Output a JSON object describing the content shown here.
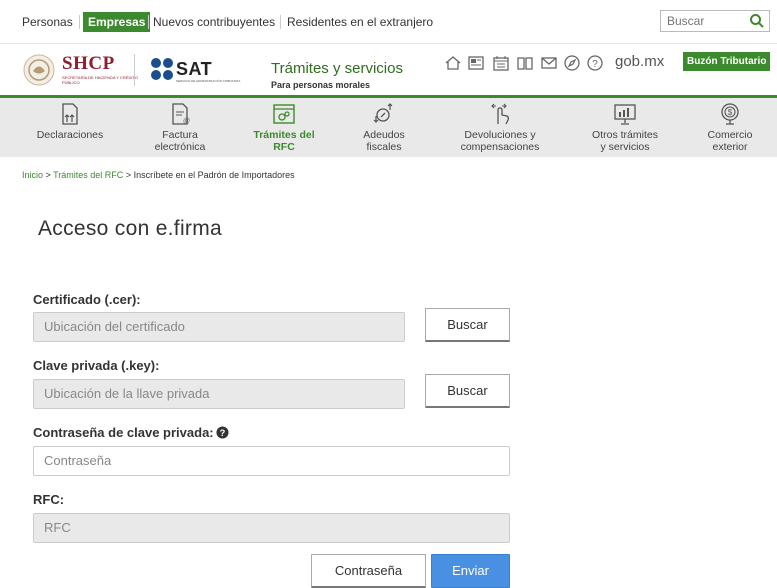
{
  "topbar": {
    "items": [
      "Personas",
      "Empresas",
      "Nuevos contribuyentes",
      "Residentes en el extranjero"
    ],
    "search_placeholder": "Buscar"
  },
  "brand": {
    "shcp": "SHCP",
    "shcp_sub": "SECRETARÍA DE HACIENDA Y CRÉDITO PÚBLICO",
    "sat": "SAT",
    "sat_sub": "SERVICIO DE ADMINISTRACIÓN TRIBUTARIA",
    "title": "Trámites y servicios",
    "subtitle": "Para personas morales",
    "gobmx": "gob.mx",
    "buzon": "Buzón Tributario"
  },
  "nav": {
    "items": [
      {
        "label1": "Declaraciones",
        "label2": ""
      },
      {
        "label1": "Factura",
        "label2": "electrónica"
      },
      {
        "label1": "Trámites del",
        "label2": "RFC"
      },
      {
        "label1": "Adeudos",
        "label2": "fiscales"
      },
      {
        "label1": "Devoluciones y",
        "label2": "compensaciones"
      },
      {
        "label1": "Otros trámites",
        "label2": "y servicios"
      },
      {
        "label1": "Comercio",
        "label2": "exterior"
      }
    ]
  },
  "breadcrumb": {
    "home": "Inicio",
    "sep": " > ",
    "section": "Trámites del RFC",
    "current": "Inscríbete en el Padrón de Importadores"
  },
  "form": {
    "title": "Acceso con e.firma",
    "cert_label": "Certificado (.cer):",
    "cert_placeholder": "Ubicación del certificado",
    "key_label": "Clave privada (.key):",
    "key_placeholder": "Ubicación de la llave privada",
    "browse_label": "Buscar",
    "password_label": "Contraseña de clave privada:",
    "password_placeholder": "Contraseña",
    "rfc_label": "RFC:",
    "rfc_placeholder": "RFC",
    "password_button": "Contraseña",
    "submit_button": "Enviar"
  },
  "colors": {
    "green": "#3c8a2e",
    "wine": "#8e1f2f",
    "blue": "#4a90e2"
  }
}
